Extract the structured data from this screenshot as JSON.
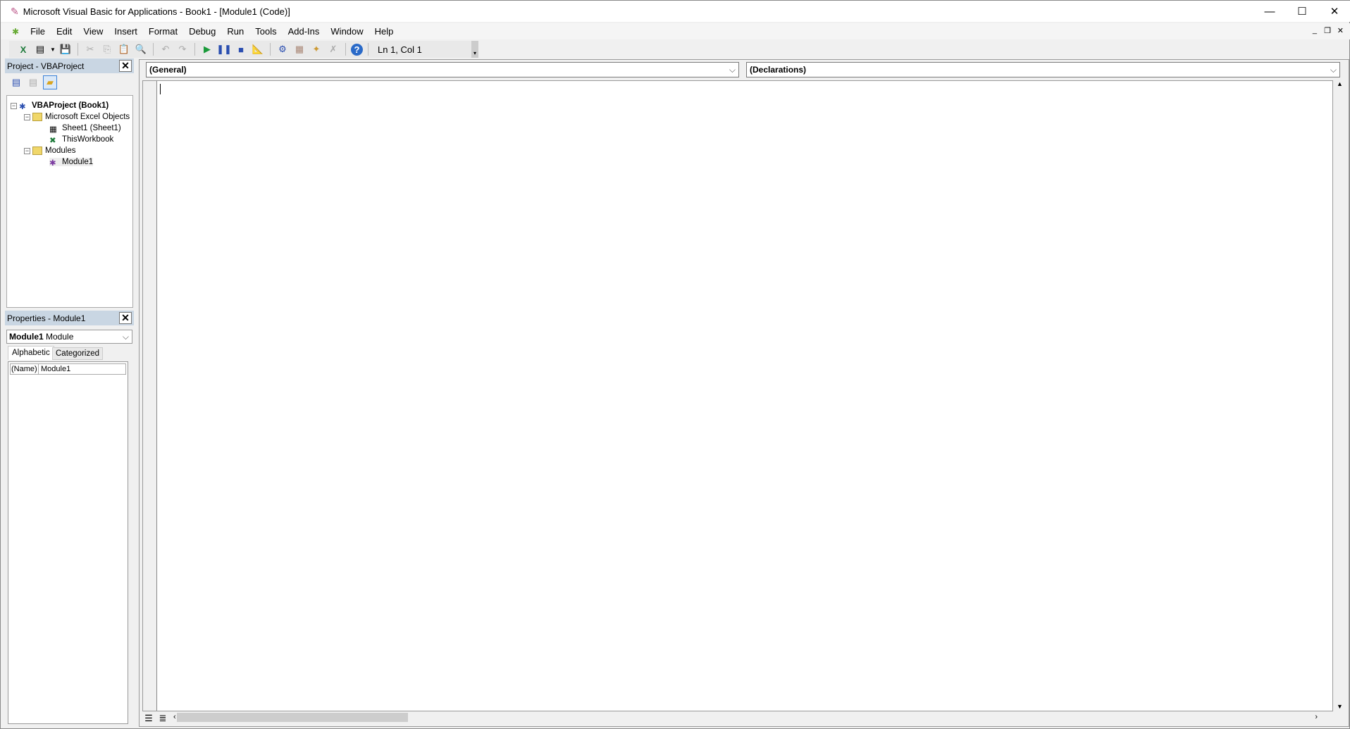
{
  "window": {
    "title": "Microsoft Visual Basic for Applications - Book1 - [Module1 (Code)]"
  },
  "menu": [
    "File",
    "Edit",
    "View",
    "Insert",
    "Format",
    "Debug",
    "Run",
    "Tools",
    "Add-Ins",
    "Window",
    "Help"
  ],
  "toolbar": {
    "position": "Ln 1, Col 1"
  },
  "project": {
    "title": "Project - VBAProject",
    "root": "VBAProject (Book1)",
    "excel_objects": "Microsoft Excel Objects",
    "sheet1": "Sheet1 (Sheet1)",
    "workbook": "ThisWorkbook",
    "modules": "Modules",
    "module1": "Module1"
  },
  "properties": {
    "title": "Properties - Module1",
    "object_name": "Module1",
    "object_type": "Module",
    "tabs": [
      "Alphabetic",
      "Categorized"
    ],
    "rows": [
      {
        "name": "(Name)",
        "value": "Module1"
      }
    ]
  },
  "code": {
    "object_combo": "(General)",
    "proc_combo": "(Declarations)"
  }
}
